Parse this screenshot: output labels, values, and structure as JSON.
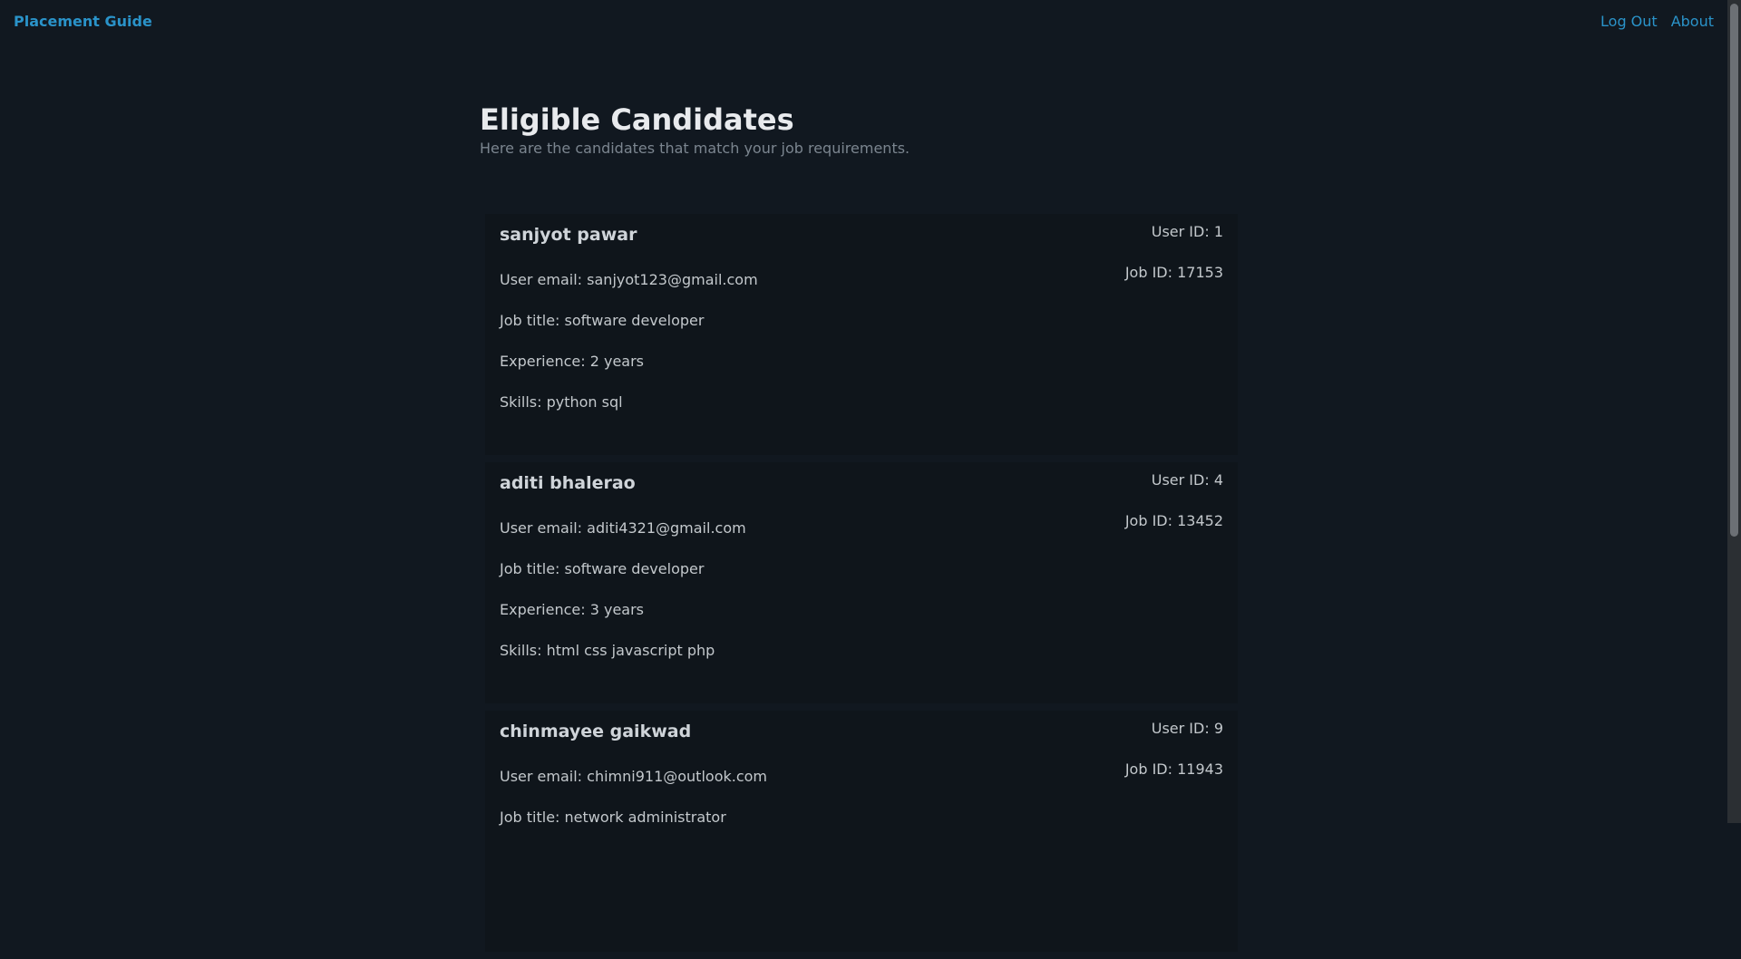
{
  "nav": {
    "brand": "Placement Guide",
    "logout": "Log Out",
    "about": "About"
  },
  "page": {
    "title": "Eligible Candidates",
    "subtitle": "Here are the candidates that match your job requirements."
  },
  "candidates": [
    {
      "name": "sanjyot pawar",
      "user_id": "User ID: 1",
      "job_id": "Job ID: 17153",
      "email": "User email: sanjyot123@gmail.com",
      "job_title": "Job title: software developer",
      "experience": "Experience: 2 years",
      "skills": "Skills: python sql"
    },
    {
      "name": "aditi bhalerao",
      "user_id": "User ID: 4",
      "job_id": "Job ID: 13452",
      "email": "User email: aditi4321@gmail.com",
      "job_title": "Job title: software developer",
      "experience": "Experience: 3 years",
      "skills": "Skills: html css javascript php"
    },
    {
      "name": "chinmayee gaikwad",
      "user_id": "User ID: 9",
      "job_id": "Job ID: 11943",
      "email": "User email: chimni911@outlook.com",
      "job_title": "Job title: network administrator",
      "experience": "",
      "skills": ""
    }
  ]
}
